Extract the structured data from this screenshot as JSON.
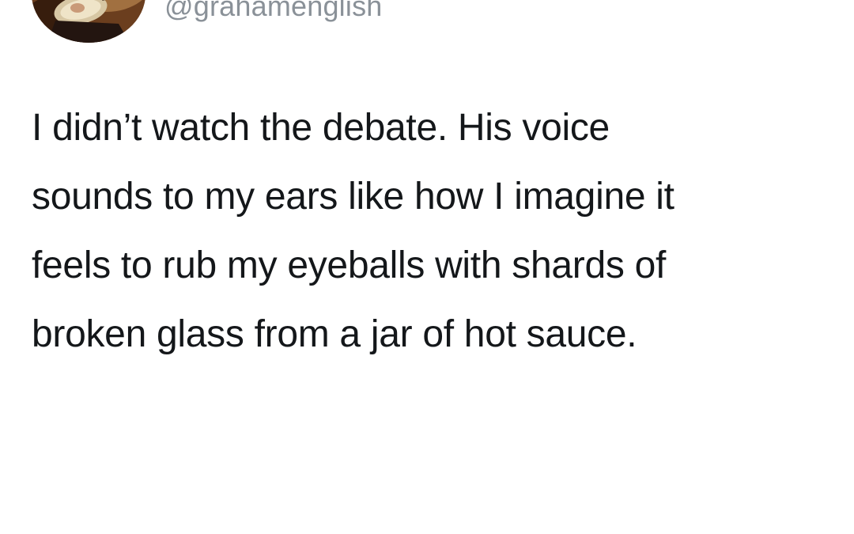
{
  "tweet": {
    "author": {
      "handle": "@grahamenglish",
      "avatar_icon": "profile-photo-guitar"
    },
    "text_lines": [
      "I didn’t watch the debate. His voice",
      "sounds to my ears like how I imagine it",
      "feels to rub my eyeballs with shards of",
      "broken glass from a jar of hot sauce."
    ]
  },
  "colors": {
    "background": "#ffffff",
    "text": "#14171a",
    "handle": "#8a9198"
  }
}
